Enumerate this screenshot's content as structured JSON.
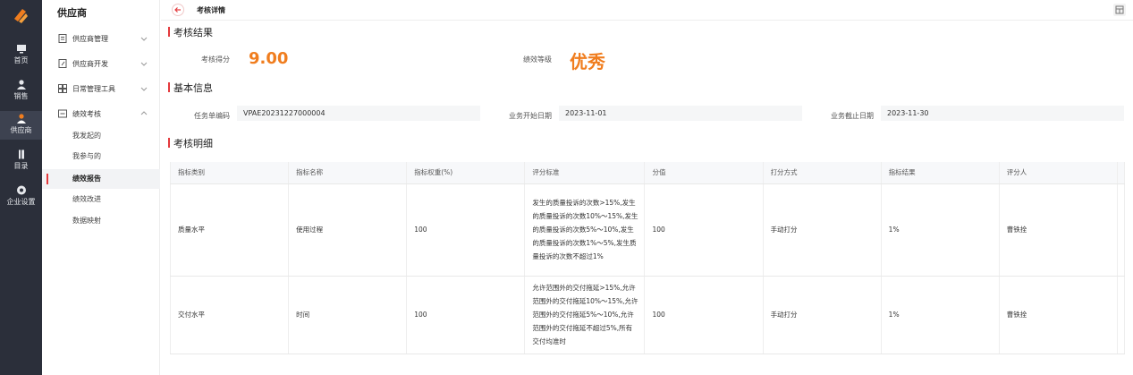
{
  "rail": {
    "items": [
      {
        "label": "首页",
        "icon": "monitor-icon"
      },
      {
        "label": "销售",
        "icon": "person-icon"
      },
      {
        "label": "供应商",
        "icon": "person-icon",
        "active": true
      },
      {
        "label": "目录",
        "icon": "book-icon"
      },
      {
        "label": "企业设置",
        "icon": "gear-icon"
      }
    ]
  },
  "submenu": {
    "title": "供应商",
    "groups": [
      {
        "label": "供应商管理",
        "icon": "document-icon"
      },
      {
        "label": "供应商开发",
        "icon": "edit-document-icon"
      },
      {
        "label": "日常管理工具",
        "icon": "grid-icon"
      },
      {
        "label": "绩效考核",
        "icon": "chart-icon",
        "expanded": true
      }
    ],
    "children": [
      "我发起的",
      "我参与的",
      "绩效报告",
      "绩效改进",
      "数据映射"
    ],
    "active_child": "绩效报告"
  },
  "topbar": {
    "title": "考核详情"
  },
  "result": {
    "section_title": "考核结果",
    "score_label": "考核得分",
    "score_value": "9.00",
    "grade_label": "绩效等级",
    "grade_value": "优秀"
  },
  "basic": {
    "section_title": "基本信息",
    "task_label": "任务单编码",
    "task_value": "VPAE20231227000004",
    "start_label": "业务开始日期",
    "start_value": "2023-11-01",
    "end_label": "业务截止日期",
    "end_value": "2023-11-30"
  },
  "detail": {
    "section_title": "考核明细",
    "columns": [
      "指标类别",
      "指标名称",
      "指标权重(%)",
      "评分标准",
      "分值",
      "打分方式",
      "指标结果",
      "评分人"
    ],
    "rows": [
      [
        "质量水平",
        "使用过程",
        "100",
        "发生的质量投诉的次数>15%,发生的质量投诉的次数10%～15%,发生的质量投诉的次数5%～10%,发生的质量投诉的次数1%～5%,发生质量投诉的次数不超过1%",
        "100",
        "手动打分",
        "1%",
        "曹铁拴"
      ],
      [
        "交付水平",
        "时间",
        "100",
        "允许范围外的交付拖延>15%,允许范围外的交付拖延10%～15%,允许范围外的交付拖延5%～10%,允许范围外的交付拖延不超过5%,所有交付均准时",
        "100",
        "手动打分",
        "1%",
        "曹铁拴"
      ]
    ]
  },
  "colors": {
    "accent": "#e4393c",
    "score": "#f07d1e",
    "rail": "#2b2f3a"
  }
}
